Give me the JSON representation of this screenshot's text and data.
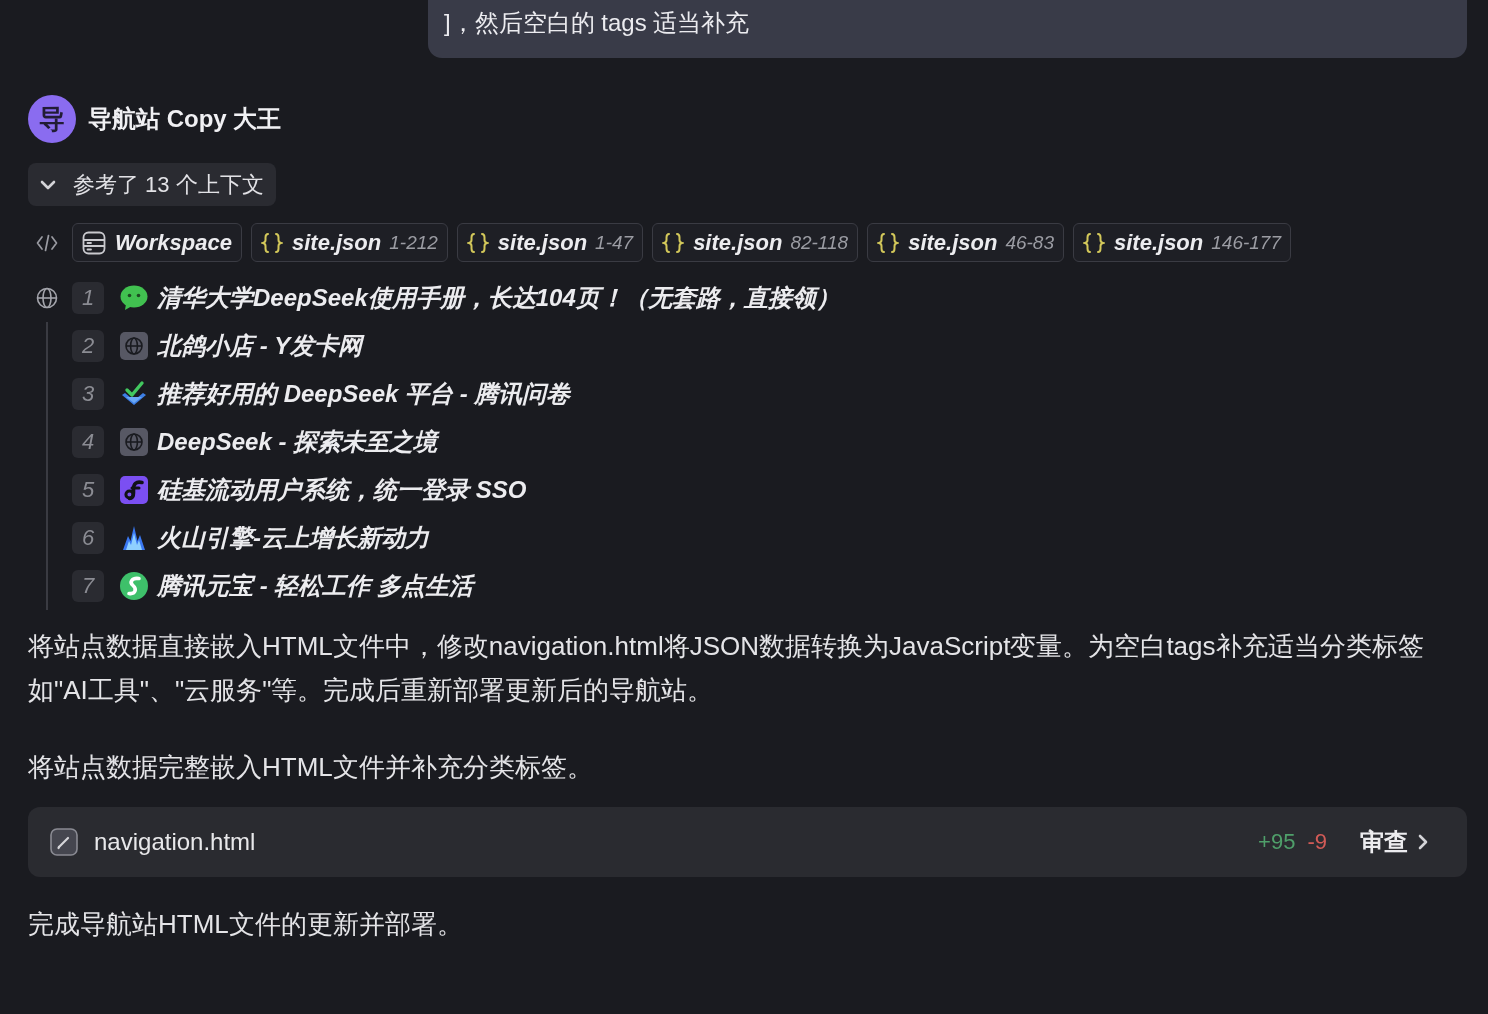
{
  "user_message": {
    "text": "]，然后空白的 tags 适当补充"
  },
  "assistant": {
    "avatar_letter": "导",
    "name": "导航站 Copy 大王"
  },
  "context": {
    "label": "参考了 13 个上下文",
    "expanded": true,
    "chips": [
      {
        "kind": "workspace",
        "label": "Workspace"
      },
      {
        "kind": "file",
        "label": "site.json",
        "range": "1-212"
      },
      {
        "kind": "file",
        "label": "site.json",
        "range": "1-47"
      },
      {
        "kind": "file",
        "label": "site.json",
        "range": "82-118"
      },
      {
        "kind": "file",
        "label": "site.json",
        "range": "46-83"
      },
      {
        "kind": "file",
        "label": "site.json",
        "range": "146-177"
      }
    ],
    "sources": [
      {
        "number": "1",
        "kind": "chat",
        "title": "清华大学DeepSeek使用手册，长达104页！（无套路，直接领）"
      },
      {
        "number": "2",
        "kind": "globe",
        "title": "北鸽小店 - Y发卡网"
      },
      {
        "number": "3",
        "kind": "check",
        "title": "推荐好用的 DeepSeek 平台 - 腾讯问卷"
      },
      {
        "number": "4",
        "kind": "globe",
        "title": "DeepSeek - 探索未至之境"
      },
      {
        "number": "5",
        "kind": "curve",
        "title": "硅基流动用户系统，统一登录 SSO"
      },
      {
        "number": "6",
        "kind": "peaks",
        "title": "火山引擎-云上增长新动力"
      },
      {
        "number": "7",
        "kind": "swirl",
        "title": "腾讯元宝 - 轻松工作 多点生活"
      }
    ]
  },
  "body": [
    {
      "kind": "text",
      "text": "将站点数据直接嵌入HTML文件中，修改navigation.html将JSON数据转换为JavaScript变量。为空白tags补充适当分类标签如\"AI工具\"、\"云服务\"等。完成后重新部署更新后的导航站。"
    },
    {
      "kind": "text",
      "text": "将站点数据完整嵌入HTML文件并补充分类标签。"
    },
    {
      "kind": "file_change",
      "file": "navigation.html",
      "added": "+95",
      "removed": "-9",
      "action": "审查"
    },
    {
      "kind": "text",
      "text": "完成导航站HTML文件的更新并部署。"
    }
  ]
}
